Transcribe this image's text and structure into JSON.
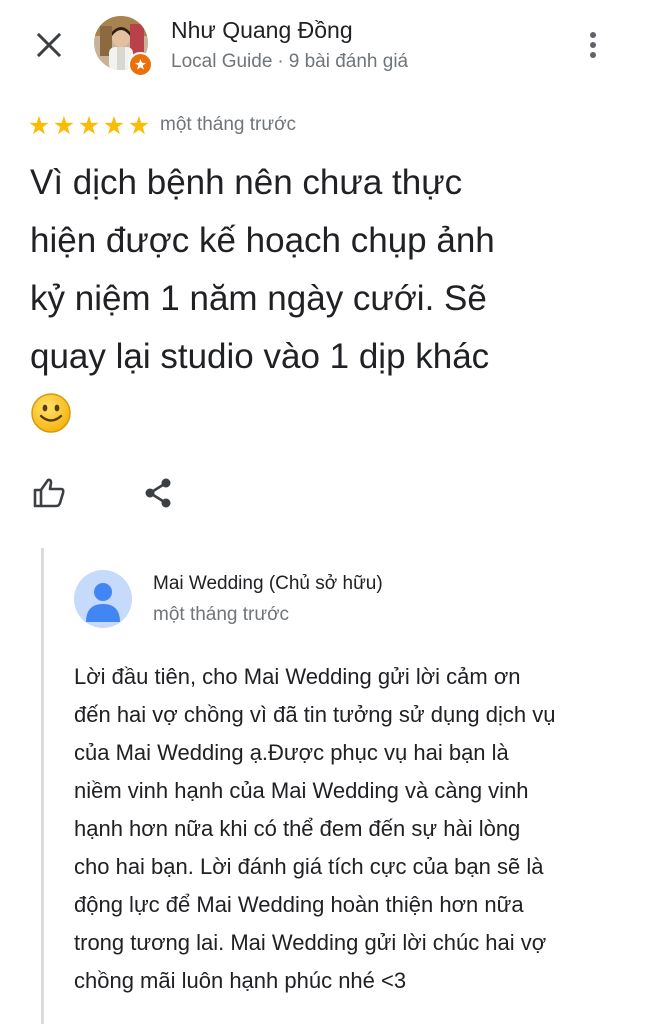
{
  "header": {
    "author_name": "Như Quang Đồng",
    "author_level": "Local Guide",
    "separator": "·",
    "review_count": "9 bài đánh giá",
    "close_icon": "close-icon",
    "more_icon": "more-vert-icon",
    "badge_icon": "local-guide-badge-icon"
  },
  "review": {
    "rating": 5,
    "rating_max": 5,
    "star_glyph": "★",
    "time": "một tháng trước",
    "lines": [
      "Vì dịch bệnh nên chưa thực",
      "hiện được kế hoạch chụp ảnh",
      "kỷ niệm 1 năm ngày cưới. Sẽ",
      "quay lại studio vào 1 dịp khác"
    ],
    "emoji": "smiley-icon"
  },
  "actions": {
    "like_icon": "thumb-up-icon",
    "share_icon": "share-icon"
  },
  "owner_reply": {
    "name": "Mai Wedding (Chủ sở hữu)",
    "time": "một tháng trước",
    "avatar_icon": "person-avatar-icon",
    "lines": [
      "Lời đầu tiên, cho Mai Wedding gửi lời cảm ơn",
      "đến hai vợ chồng vì đã tin tưởng sử dụng dịch vụ",
      "của Mai Wedding ạ.Được phục vụ hai bạn là",
      "niềm vinh hạnh của Mai Wedding và càng vinh",
      "hạnh hơn nữa khi có thể đem đến sự hài lòng",
      "cho hai bạn. Lời đánh giá tích cực của bạn sẽ là",
      "động lực để Mai Wedding hoàn thiện hơn nữa",
      "trong tương lai. Mai Wedding gửi lời chúc hai vợ",
      "chồng mãi luôn hạnh phúc nhé <3"
    ]
  },
  "colors": {
    "star": "#fbbc04",
    "meta_text": "#70757a",
    "primary_text": "#202124",
    "owner_avatar_bg": "#c6dafc",
    "owner_avatar_fg": "#4285f4",
    "badge": "#e8710a"
  }
}
